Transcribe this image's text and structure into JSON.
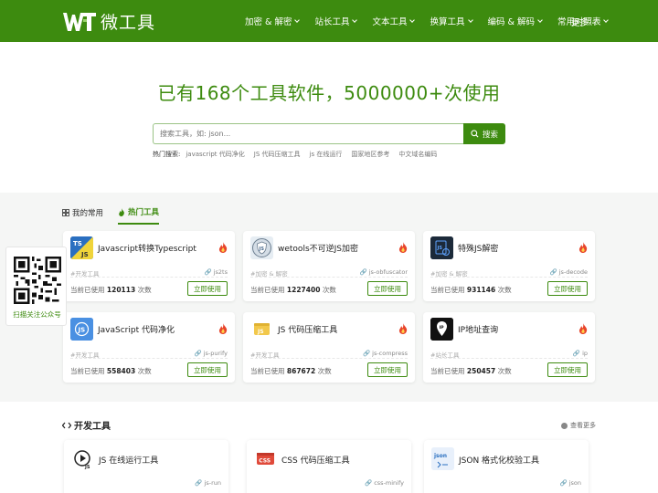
{
  "brand": {
    "logo_mark": "WT",
    "name": "微工具",
    "primary_color": "#3d8b0f"
  },
  "nav": {
    "items": [
      {
        "label": "加密 & 解密"
      },
      {
        "label": "站长工具"
      },
      {
        "label": "文本工具"
      },
      {
        "label": "换算工具"
      },
      {
        "label": "编码 & 解码"
      },
      {
        "label": "常用对照表"
      }
    ],
    "more": "更多⋯"
  },
  "hero": {
    "title": "已有168个工具软件，5000000+次使用",
    "search_placeholder": "搜索工具，如: json...",
    "search_button": "搜索",
    "hot_label": "热门搜索:",
    "hot_links": [
      "javascript 代码净化",
      "JS 代码压缩工具",
      "js 在线运行",
      "国家地区参考",
      "中文域名编码"
    ]
  },
  "tabs": {
    "favorites": "我的常用",
    "hot": "热门工具"
  },
  "hot_tools": [
    {
      "title": "Javascript转换Typescript",
      "category": "#开发工具",
      "slug": "js2ts",
      "count_prefix": "当前已使用",
      "count": "120113",
      "count_suffix": "次数",
      "button": "立即使用",
      "icon": "ts-js-icon"
    },
    {
      "title": "wetools不可逆JS加密",
      "category": "#加密 & 解密",
      "slug": "js-obfuscator",
      "count_prefix": "当前已使用",
      "count": "1227400",
      "count_suffix": "次数",
      "button": "立即使用",
      "icon": "shield-js-icon"
    },
    {
      "title": "特殊JS解密",
      "category": "#加密 & 解密",
      "slug": "js-decode",
      "count_prefix": "当前已使用",
      "count": "931146",
      "count_suffix": "次数",
      "button": "立即使用",
      "icon": "js-decode-icon"
    },
    {
      "title": "JavaScript 代码净化",
      "category": "#开发工具",
      "slug": "js-purify",
      "count_prefix": "当前已使用",
      "count": "558403",
      "count_suffix": "次数",
      "button": "立即使用",
      "icon": "js-purify-icon"
    },
    {
      "title": "JS 代码压缩工具",
      "category": "#开发工具",
      "slug": "js-compress",
      "count_prefix": "当前已使用",
      "count": "867672",
      "count_suffix": "次数",
      "button": "立即使用",
      "icon": "js-compress-icon"
    },
    {
      "title": "IP地址查询",
      "category": "#站长工具",
      "slug": "ip",
      "count_prefix": "当前已使用",
      "count": "250457",
      "count_suffix": "次数",
      "button": "立即使用",
      "icon": "ip-icon"
    }
  ],
  "dev_section": {
    "title": "开发工具",
    "view_more": "查看更多",
    "tools": [
      {
        "title": "JS 在线运行工具",
        "slug": "js-run",
        "icon": "play-js-icon"
      },
      {
        "title": "CSS 代码压缩工具",
        "slug": "css-minify",
        "icon": "css-icon"
      },
      {
        "title": "JSON 格式化校验工具",
        "slug": "json",
        "icon": "json-icon"
      }
    ]
  },
  "qr": {
    "label": "扫描关注公众号"
  }
}
